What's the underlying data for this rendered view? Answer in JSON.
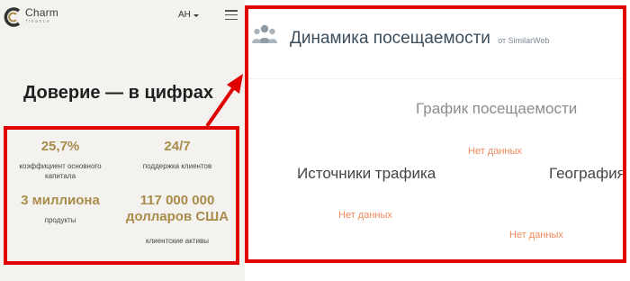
{
  "mobile": {
    "logo": {
      "name": "Charm",
      "sub": "finance"
    },
    "lang": "AH",
    "section_title": "Доверие — в цифрах",
    "stats": [
      {
        "value": "25,7%",
        "label": "коэффициент основного капитала"
      },
      {
        "value": "24/7",
        "label": "поддержка клиентов"
      },
      {
        "value": "3 миллиона",
        "label": "продукты"
      },
      {
        "value": "117 000 000 долларов США",
        "label": "клиентские активы"
      }
    ]
  },
  "widget": {
    "title": "Динамика посещаемости",
    "source": "от SimilarWeb",
    "sections": {
      "traffic_chart": "График посещаемости",
      "traffic_sources": "Источники трафика",
      "geography": "География"
    },
    "no_data": "Нет данных"
  },
  "colors": {
    "accent_red": "#e00000",
    "gold": "#a88c4a",
    "no_data": "#ef8a5c"
  }
}
